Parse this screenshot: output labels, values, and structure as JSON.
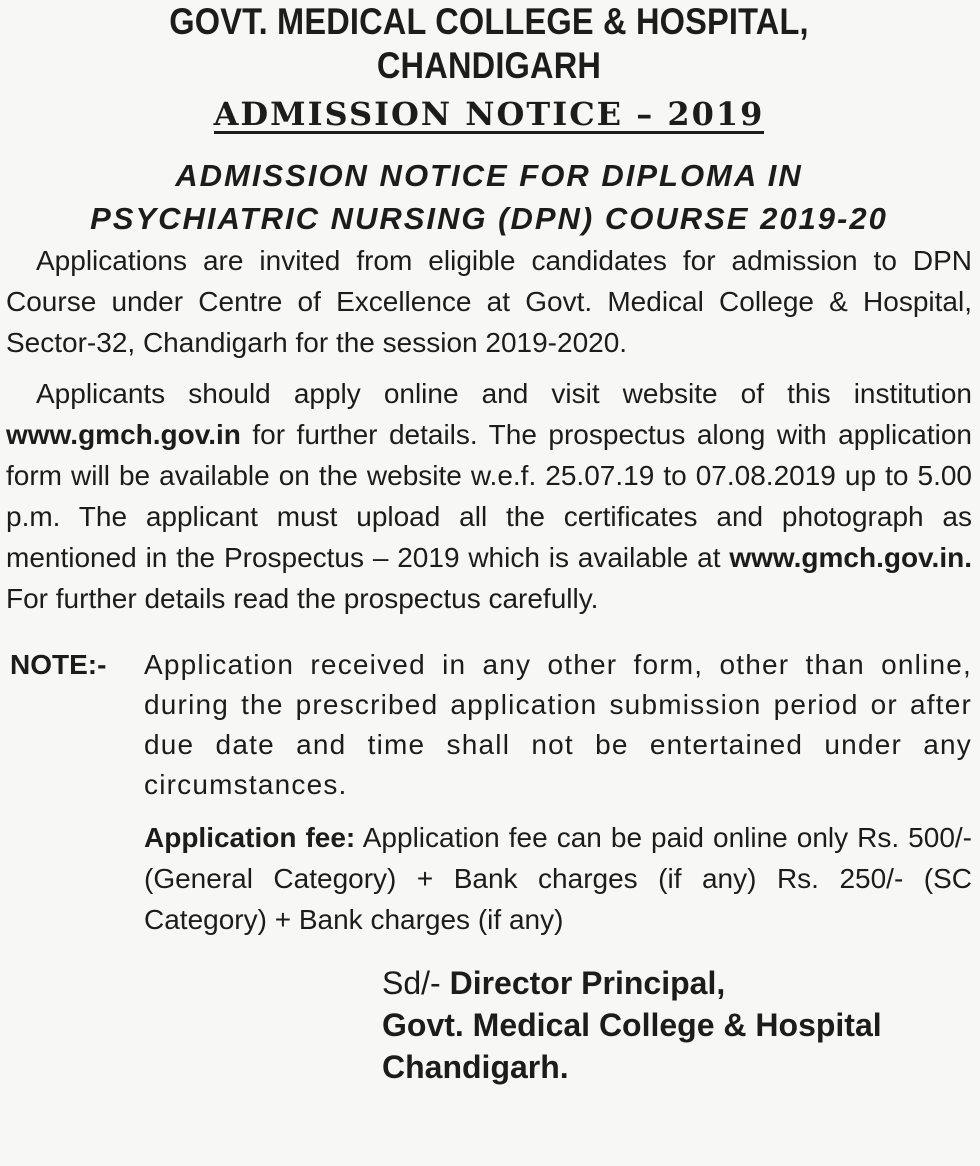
{
  "header": {
    "institution": "GOVT. MEDICAL COLLEGE & HOSPITAL, CHANDIGARH",
    "notice_title": "ADMISSION NOTICE – 2019"
  },
  "course_title": {
    "line1": "ADMISSION NOTICE FOR DIPLOMA IN",
    "line2": "PSYCHIATRIC NURSING (DPN) COURSE 2019-20"
  },
  "paragraph1": {
    "text": "Applications are invited from eligible candidates for admission to DPN Course under Centre of Excellence at Govt. Medical College & Hospital, Sector-32, Chandigarh for the session 2019-2020."
  },
  "paragraph2": {
    "part1": "Applicants should apply online and visit website of this institution",
    "url1": "www.gmch.gov.in",
    "part2": " for further details. The prospectus along with application form will be available on the website w.e.f. 25.07.19 to 07.08.2019 up to 5.00 p.m. The applicant must upload all the certificates and photograph as mentioned in the Prospectus – 2019 which is available at ",
    "url2": "www.gmch.gov.in.",
    "part3": " For further details read the prospectus carefully."
  },
  "note": {
    "label": "NOTE:-",
    "text": "Application received in any other form, other than online, during the prescribed application submission period or after due date and time shall not be entertained under any circumstances."
  },
  "fee": {
    "label": "Application fee:",
    "text": " Application fee can be paid online only Rs. 500/- (General Category) + Bank charges (if any) Rs. 250/- (SC Category) + Bank charges (if any)"
  },
  "signature": {
    "sd": "Sd/-",
    "title": " Director Principal,",
    "institution": "Govt. Medical College & Hospital",
    "city": "Chandigarh."
  }
}
